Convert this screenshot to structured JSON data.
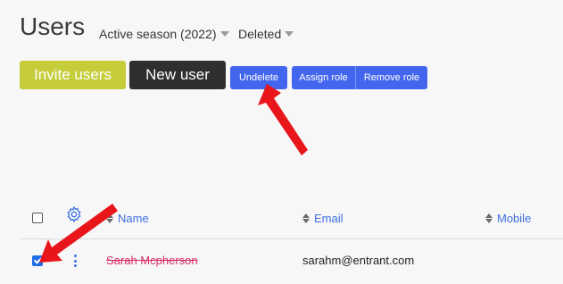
{
  "header": {
    "title": "Users",
    "filters": [
      {
        "label": "Active season (2022)"
      },
      {
        "label": "Deleted"
      }
    ]
  },
  "toolbar": {
    "invite_label": "Invite users",
    "new_user_label": "New user",
    "undelete_label": "Undelete",
    "assign_role_label": "Assign role",
    "remove_role_label": "Remove role"
  },
  "table": {
    "columns": [
      "Name",
      "Email",
      "Mobile"
    ],
    "rows": [
      {
        "name": "Sarah Mcpherson",
        "email": "sarahm@entrant.com",
        "mobile": "",
        "selected": true,
        "deleted": true
      }
    ]
  },
  "colors": {
    "invite": "#c5cd3a",
    "new_user": "#2f2f2f",
    "action_blue": "#4466ee",
    "link_blue": "#3d6fe0",
    "deleted_name": "#d8306a",
    "annotation_arrow": "#e8151b"
  },
  "icons": {
    "settings": "gear-icon",
    "row_menu": "kebab-menu-icon",
    "sort": "sort-arrows-icon",
    "dropdown": "caret-down-icon"
  }
}
